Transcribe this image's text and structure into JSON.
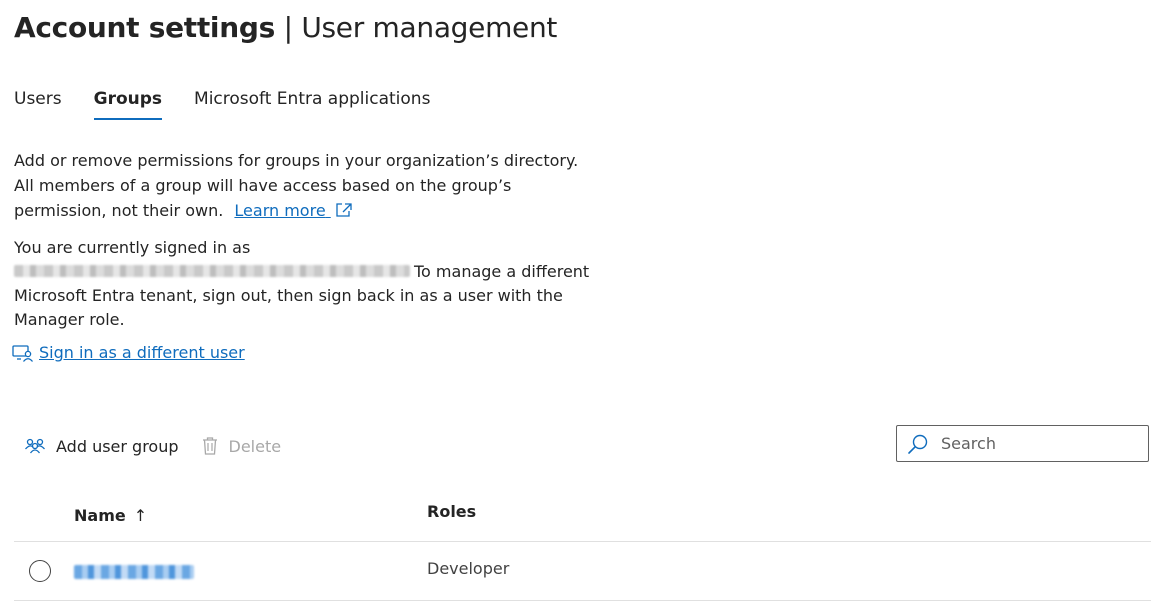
{
  "header": {
    "title_bold": "Account settings",
    "separator": "|",
    "title_light": "User management"
  },
  "tabs": [
    {
      "label": "Users",
      "active": false
    },
    {
      "label": "Groups",
      "active": true
    },
    {
      "label": "Microsoft Entra applications",
      "active": false
    }
  ],
  "description": {
    "line1": "Add or remove permissions for groups in your organization’s directory.",
    "line2": "All members of a group will have access based on the group’s",
    "line3": "permission, not their own.",
    "learn_more": "Learn more"
  },
  "signed_in": {
    "line1": "You are currently signed in as",
    "line2_rest": "To manage a different",
    "line3": "Microsoft Entra tenant, sign out, then sign back in as a user with the",
    "line4": "Manager role."
  },
  "signin_link": {
    "label": "Sign in as a different user"
  },
  "toolbar": {
    "add_label": "Add user group",
    "delete_label": "Delete"
  },
  "search": {
    "placeholder": "Search"
  },
  "table": {
    "columns": {
      "name": "Name",
      "sort_indicator": "↑",
      "roles": "Roles"
    },
    "rows": [
      {
        "role": "Developer"
      }
    ]
  },
  "colors": {
    "accent": "#0f6cbd",
    "text": "#242424",
    "disabled": "#a8a8a8"
  }
}
